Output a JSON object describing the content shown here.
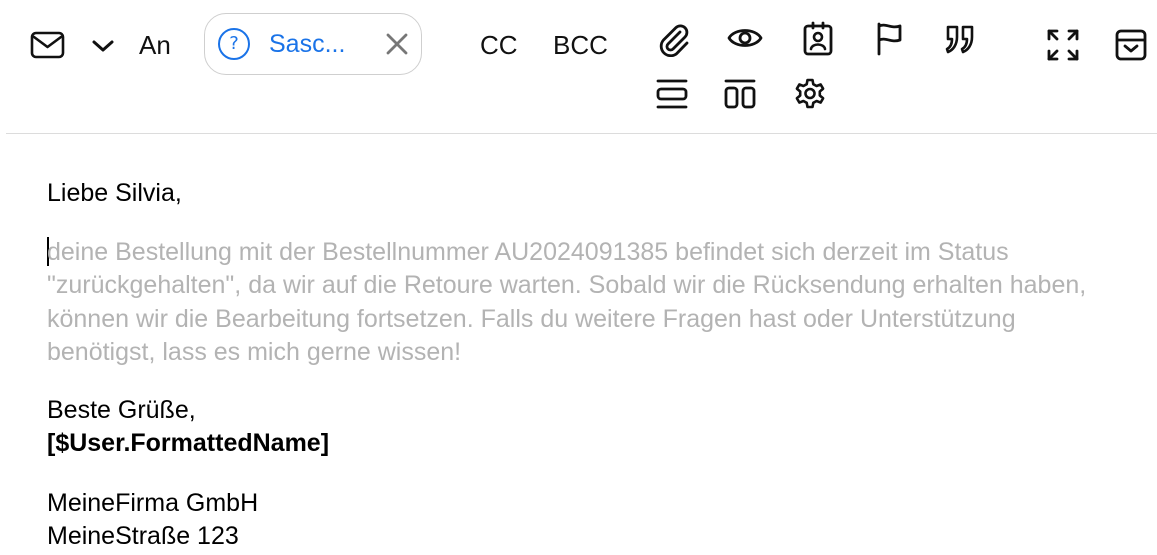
{
  "toolbar": {
    "to_label": "An",
    "recipient_chip": {
      "text": "Sasc...",
      "status_icon": "question-circle-icon",
      "remove_icon": "close-icon"
    },
    "cc_label": "CC",
    "bcc_label": "BCC",
    "icons": [
      "mail-icon",
      "chevron-down-icon",
      "paperclip-icon",
      "eye-icon",
      "contact-card-icon",
      "flag-icon",
      "quote-icon",
      "expand-icon",
      "archive-icon",
      "layout-single-icon",
      "layout-split-icon",
      "gear-icon"
    ],
    "accent_color": "#1a73e8"
  },
  "email": {
    "greeting": "Liebe Silvia,",
    "placeholder": "deine Bestellung mit der Bestellnummer AU2024091385 befindet sich derzeit im Status \"zurückgehalten\", da wir auf die Retoure warten. Sobald wir die Rücksendung erhalten haben, können wir die Bearbeitung fortsetzen. Falls du weitere Fragen hast oder Unterstützung benötigst, lass es mich gerne wissen!",
    "closing": "Beste Grüße,",
    "signature": "[$User.FormattedName]",
    "company": "MeineFirma GmbH",
    "street": "MeineStraße 123"
  }
}
